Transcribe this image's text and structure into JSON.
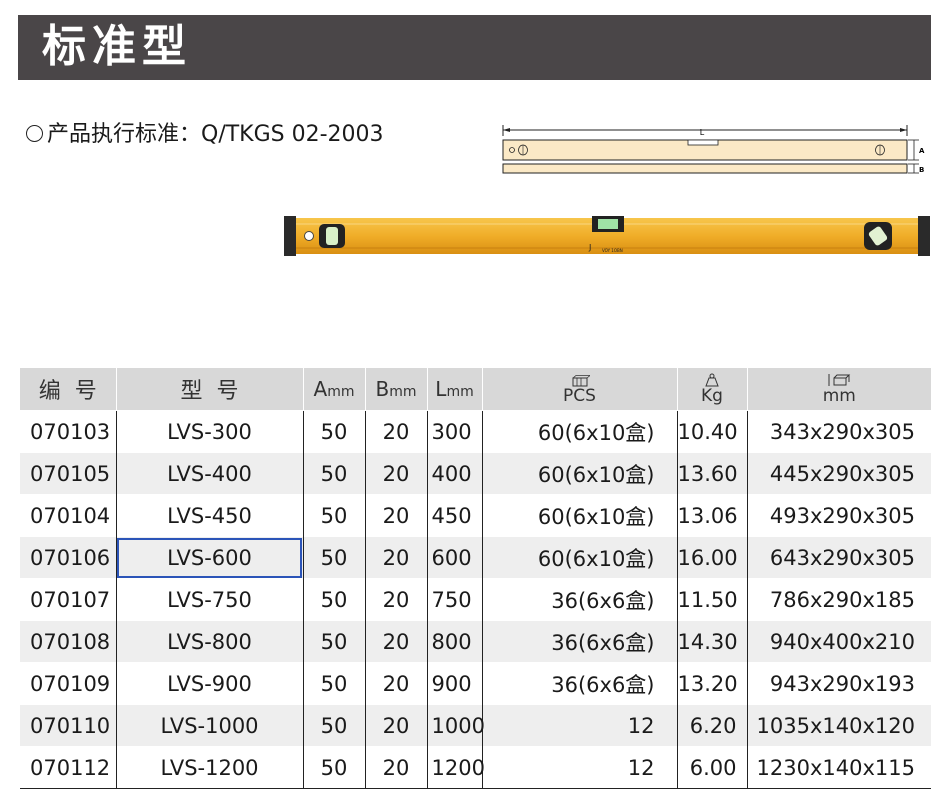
{
  "header": {
    "title": "标准型"
  },
  "standard": {
    "text": "产品执行标准：Q/TKGS 02-2003"
  },
  "diagram": {
    "label_l": "L",
    "label_a": "A",
    "label_b": "B"
  },
  "product": {
    "brand_mark": "J",
    "small_text": "VOY 1OBN"
  },
  "table": {
    "headers": {
      "code": "编号",
      "model": "型号",
      "a_big": "A",
      "a_small": "mm",
      "b_big": "B",
      "b_small": "mm",
      "l_big": "L",
      "l_small": "mm",
      "pcs": "PCS",
      "kg": "Kg",
      "box": "mm"
    },
    "icons": {
      "pcs": "carton-stack-icon",
      "kg": "weight-icon",
      "box": "box-dimension-icon"
    },
    "rows": [
      {
        "code": "070103",
        "model": "LVS-300",
        "a": "50",
        "b": "20",
        "l": "300",
        "pcs": "60(6x10盒)",
        "kg": "10.40",
        "box": "343x290x305"
      },
      {
        "code": "070105",
        "model": "LVS-400",
        "a": "50",
        "b": "20",
        "l": "400",
        "pcs": "60(6x10盒)",
        "kg": "13.60",
        "box": "445x290x305"
      },
      {
        "code": "070104",
        "model": "LVS-450",
        "a": "50",
        "b": "20",
        "l": "450",
        "pcs": "60(6x10盒)",
        "kg": "13.06",
        "box": "493x290x305"
      },
      {
        "code": "070106",
        "model": "LVS-600",
        "a": "50",
        "b": "20",
        "l": "600",
        "pcs": "60(6x10盒)",
        "kg": "16.00",
        "box": "643x290x305"
      },
      {
        "code": "070107",
        "model": "LVS-750",
        "a": "50",
        "b": "20",
        "l": "750",
        "pcs": "36(6x6盒)",
        "kg": "11.50",
        "box": "786x290x185"
      },
      {
        "code": "070108",
        "model": "LVS-800",
        "a": "50",
        "b": "20",
        "l": "800",
        "pcs": "36(6x6盒)",
        "kg": "14.30",
        "box": "940x400x210"
      },
      {
        "code": "070109",
        "model": "LVS-900",
        "a": "50",
        "b": "20",
        "l": "900",
        "pcs": "36(6x6盒)",
        "kg": "13.20",
        "box": "943x290x193"
      },
      {
        "code": "070110",
        "model": "LVS-1000",
        "a": "50",
        "b": "20",
        "l": "1000",
        "pcs": "12",
        "kg": "6.20",
        "box": "1035x140x120"
      },
      {
        "code": "070112",
        "model": "LVS-1200",
        "a": "50",
        "b": "20",
        "l": "1200",
        "pcs": "12",
        "kg": "6.00",
        "box": "1230x140x115"
      }
    ]
  },
  "colors": {
    "title_bar": "#4a4648",
    "header_row": "#d8d8d8",
    "shaded_row": "#eeeeee",
    "level_body": "#f2b233",
    "highlight": "#2b54b8"
  }
}
